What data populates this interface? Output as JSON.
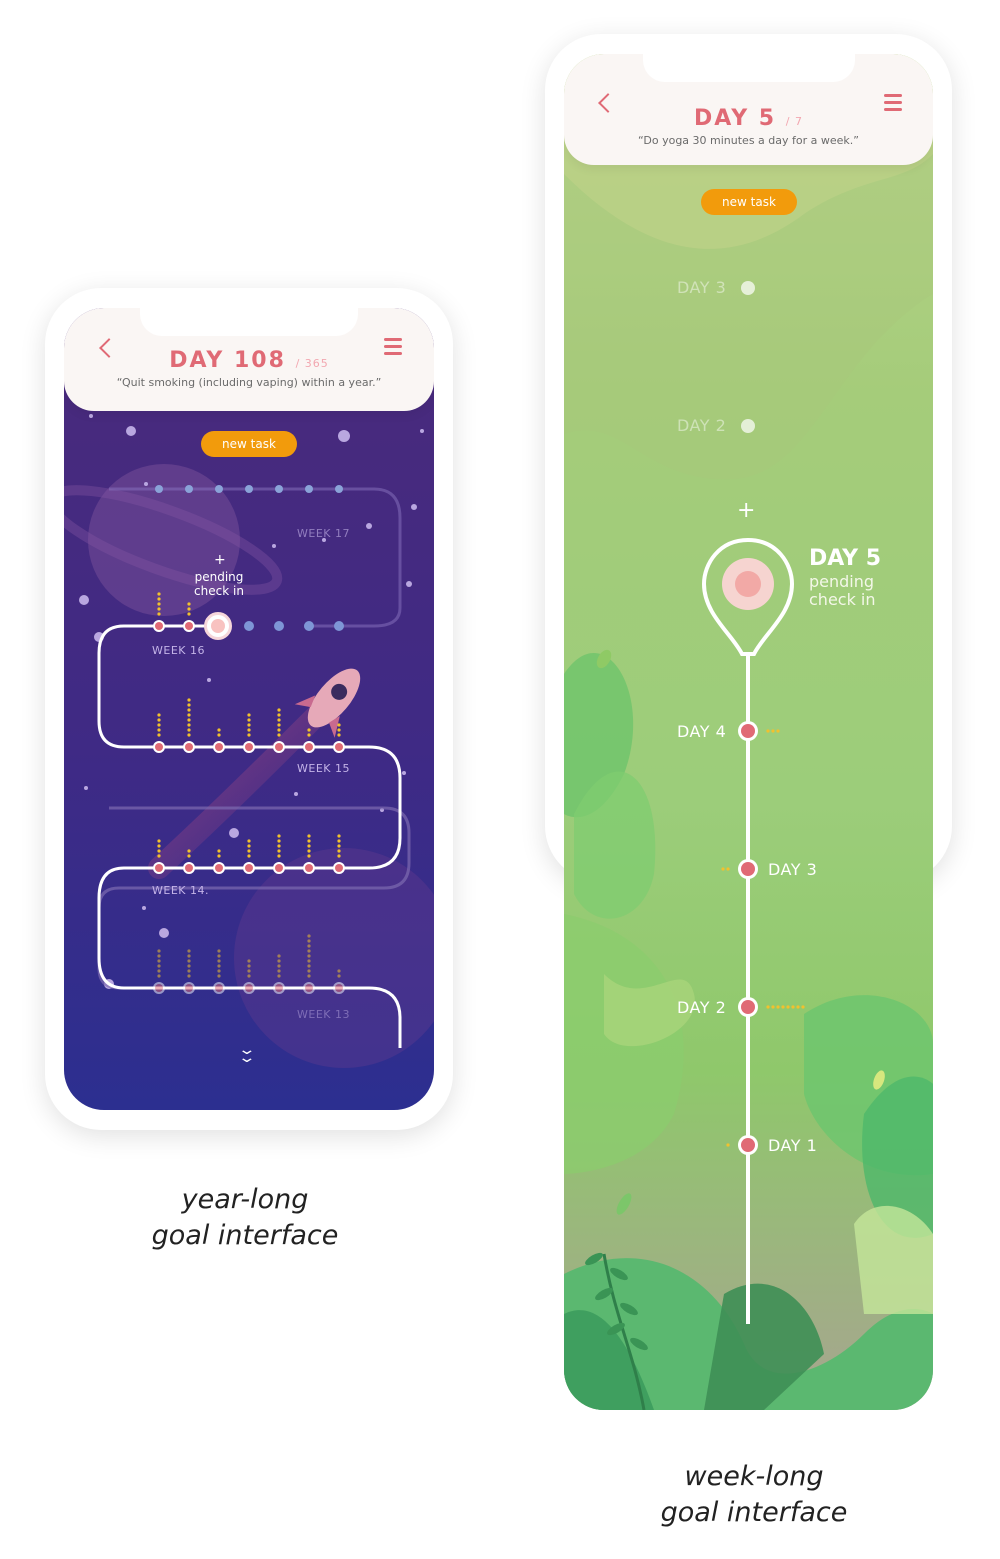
{
  "year_goal": {
    "day_title": "DAY 108",
    "day_total": "/ 365",
    "quote": "“Quit smoking (including vaping) within a year.”",
    "new_task_label": "new task",
    "plus": "+",
    "pending_line1": "pending",
    "pending_line2": "check in",
    "week_labels": [
      "WEEK 17",
      "WEEK 16",
      "WEEK 15",
      "WEEK 14.",
      "WEEK 13"
    ],
    "caption_line1": "year-long",
    "caption_line2": "goal interface",
    "colors": {
      "accent": "#e06a75",
      "button": "#f29b0c",
      "space_top": "#4b2a7d",
      "space_bottom": "#2b2d8f"
    }
  },
  "week_goal": {
    "day_title": "DAY 5",
    "day_total": "/ 7",
    "quote": "“Do yoga 30 minutes a day for a week.”",
    "new_task_label": "new task",
    "faded_days": [
      "DAY 3",
      "DAY 2"
    ],
    "plus": "+",
    "current_day": "DAY 5",
    "pending_line1": "pending",
    "pending_line2": "check in",
    "timeline_days": [
      "DAY 4",
      "DAY 3",
      "DAY 2",
      "DAY 1"
    ],
    "caption_line1": "week-long",
    "caption_line2": "goal interface",
    "colors": {
      "accent": "#e06a75",
      "button": "#f29b0c",
      "leaf_light": "#b7d77e",
      "leaf_dark": "#3fa85f"
    }
  }
}
